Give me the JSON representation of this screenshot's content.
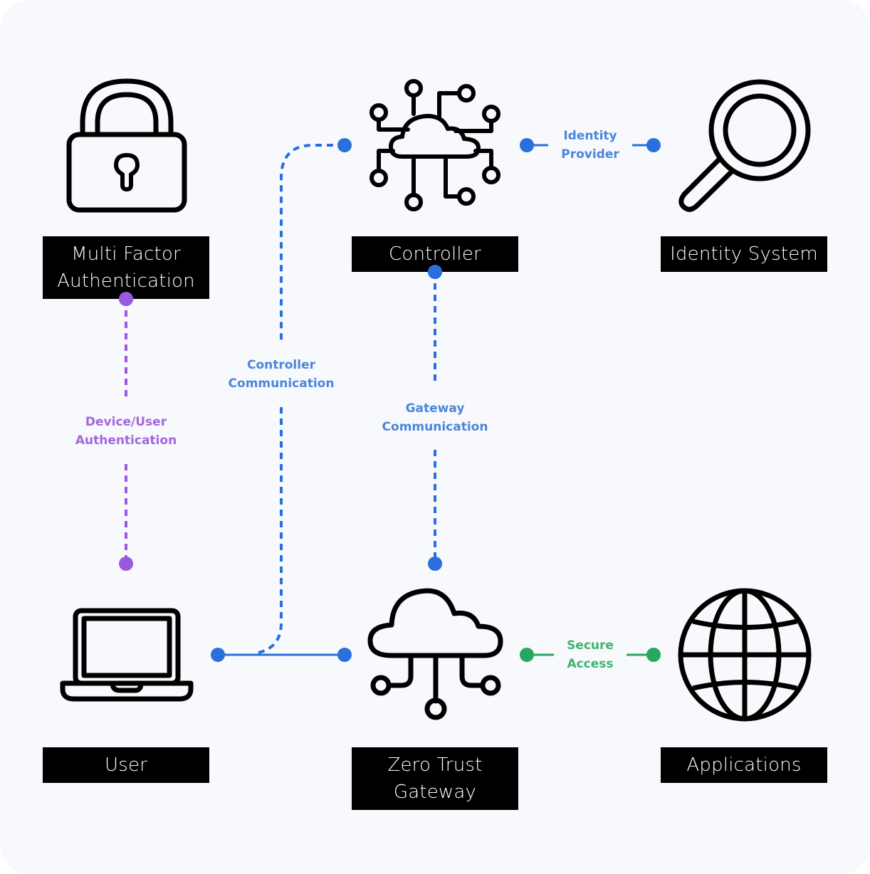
{
  "colors": {
    "background": "#f7f9fd",
    "label_bg": "#000000",
    "label_text": "#ffffff",
    "blue": "#2a6fdc",
    "purple": "#9b59e0",
    "green": "#27a85f",
    "blue_text": "#4b86d8",
    "purple_text": "#a367dc",
    "green_text": "#3eb46f"
  },
  "nodes": {
    "mfa": {
      "label": "Multi Factor Authentication",
      "line1": "Multi Factor",
      "line2": "Authentication",
      "icon": "padlock-icon"
    },
    "controller": {
      "label": "Controller",
      "icon": "cloud-network-icon"
    },
    "identity_system": {
      "label": "Identity System",
      "icon": "magnifying-glass-icon"
    },
    "user": {
      "label": "User",
      "icon": "laptop-icon"
    },
    "gateway": {
      "label": "Zero Trust Gateway",
      "line1": "Zero Trust",
      "line2": "Gateway",
      "icon": "cloud-gateway-icon"
    },
    "applications": {
      "label": "Applications",
      "icon": "globe-icon"
    }
  },
  "edges": {
    "identity_provider": {
      "line1": "Identity",
      "line2": "Provider",
      "from": "Controller",
      "to": "Identity System",
      "style": "solid",
      "color": "blue"
    },
    "controller_comm": {
      "line1": "Controller",
      "line2": "Communication",
      "from": "User",
      "to": "Controller",
      "style": "dashed",
      "color": "blue"
    },
    "device_user_auth": {
      "line1": "Device/User",
      "line2": "Authentication",
      "from": "Multi Factor Authentication",
      "to": "User",
      "style": "dashed",
      "color": "purple"
    },
    "gateway_comm": {
      "line1": "Gateway",
      "line2": "Communication",
      "from": "Controller",
      "to": "Zero Trust Gateway",
      "style": "dashed",
      "color": "blue"
    },
    "user_gateway": {
      "from": "User",
      "to": "Zero Trust Gateway",
      "style": "solid",
      "color": "blue"
    },
    "secure_access": {
      "line1": "Secure",
      "line2": "Access",
      "from": "Zero Trust Gateway",
      "to": "Applications",
      "style": "solid",
      "color": "green"
    }
  }
}
